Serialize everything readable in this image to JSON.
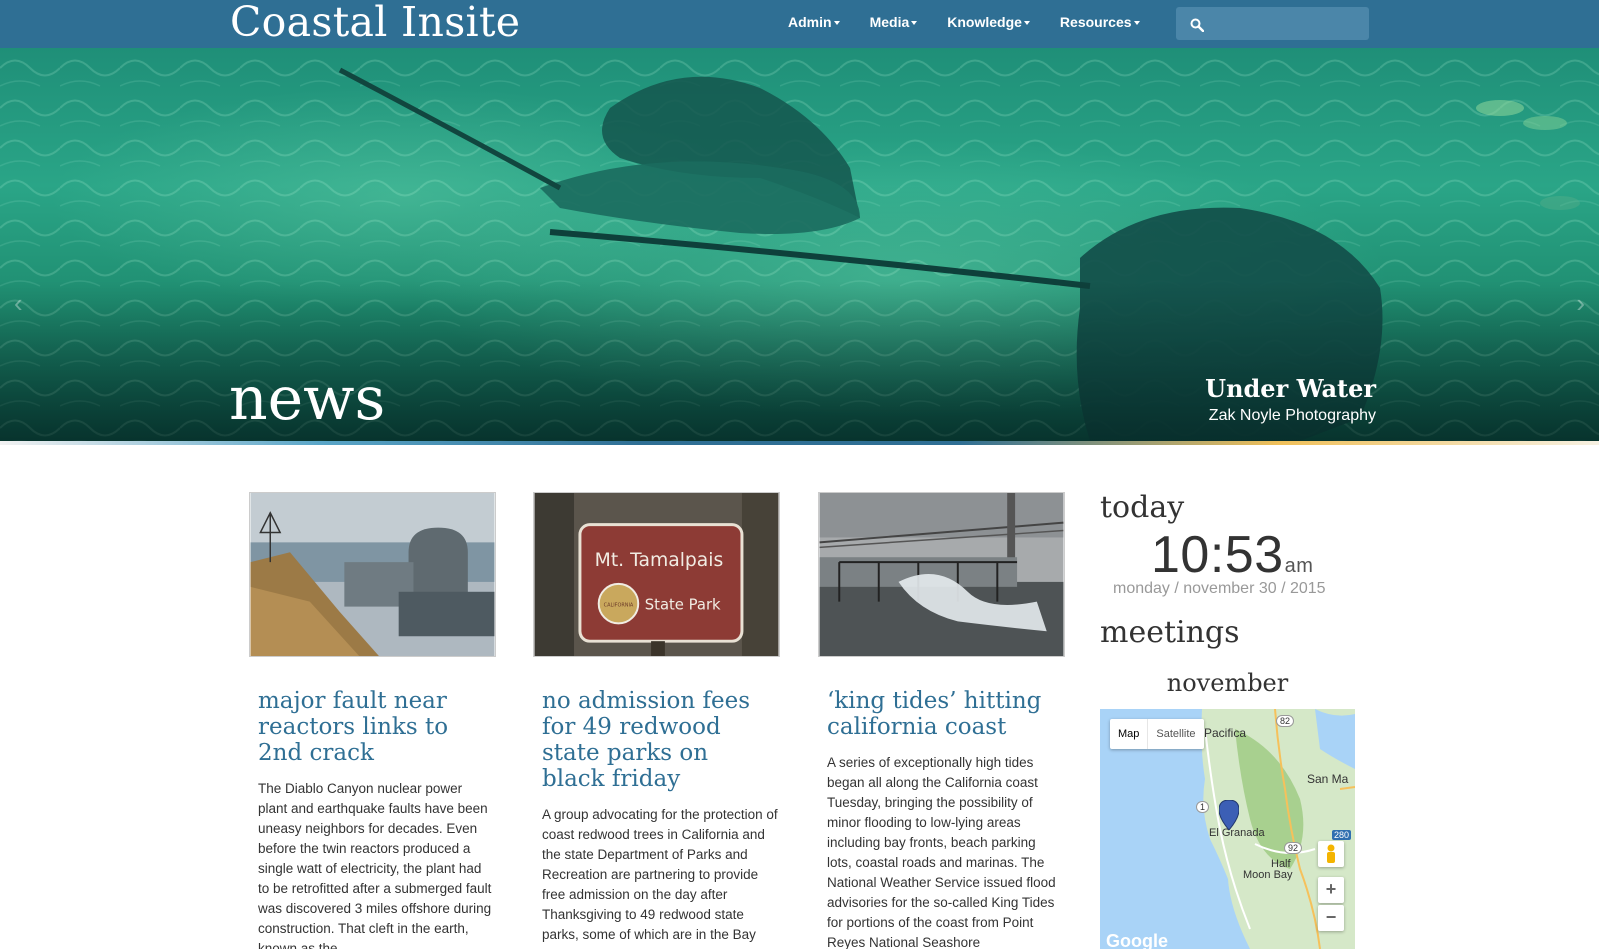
{
  "site": {
    "brand": "Coastal Insite"
  },
  "nav": {
    "items": [
      {
        "label": "Admin"
      },
      {
        "label": "Media"
      },
      {
        "label": "Knowledge"
      },
      {
        "label": "Resources"
      }
    ],
    "search": {
      "value": ""
    }
  },
  "hero": {
    "section_title": "news",
    "caption_title": "Under Water",
    "caption_credit": "Zak Noyle Photography",
    "prev_arrow": "‹",
    "next_arrow": "›"
  },
  "articles": [
    {
      "title": "major fault near reactors links to 2nd crack",
      "excerpt": "The Diablo Canyon nuclear power plant and earthquake faults have been uneasy neighbors for decades. Even before the twin reactors produced a single watt of electricity, the plant had to be retrofitted after a submerged fault was discovered 3 miles offshore during construction. That cleft in the earth, known as the"
    },
    {
      "title": "no admission fees for 49 redwood state parks on black friday",
      "excerpt": "A group advocating for the protection of coast redwood trees in California and the state Department of Parks and Recreation are partnering to provide free admission on the day after Thanksgiving to 49 redwood state parks, some of which are in the Bay Area, the group’s spokeswoman said. Save the",
      "sign_line1": "Mt. Tamalpais",
      "sign_line2": "State Park",
      "sign_seal": "CALIFORNIA"
    },
    {
      "title": "‘king tides’ hitting california coast",
      "excerpt": "A series of exceptionally high tides began all along the California coast Tuesday, bringing the possibility of minor flooding to low-lying areas including bay fronts, beach parking lots, coastal roads and marinas. The National Weather Service issued flood advisories for the so-called King Tides for portions of the coast from Point Reyes National Seashore"
    }
  ],
  "today": {
    "heading": "today",
    "time": "10:53",
    "ampm": "am",
    "date": "monday / november 30 / 2015"
  },
  "meetings": {
    "heading": "meetings",
    "month": "november",
    "map": {
      "toggle_map": "Map",
      "toggle_satellite": "Satellite",
      "places": [
        "Pacifica",
        "San Ma",
        "El Granada",
        "Half",
        "Moon Bay"
      ],
      "road_shields": [
        "82",
        "1",
        "92",
        "280"
      ],
      "zoom_in": "+",
      "zoom_out": "−",
      "logo": "Google"
    }
  },
  "colors": {
    "nav": "#2f6f94",
    "link": "#2f6f94",
    "muted": "#999999"
  }
}
